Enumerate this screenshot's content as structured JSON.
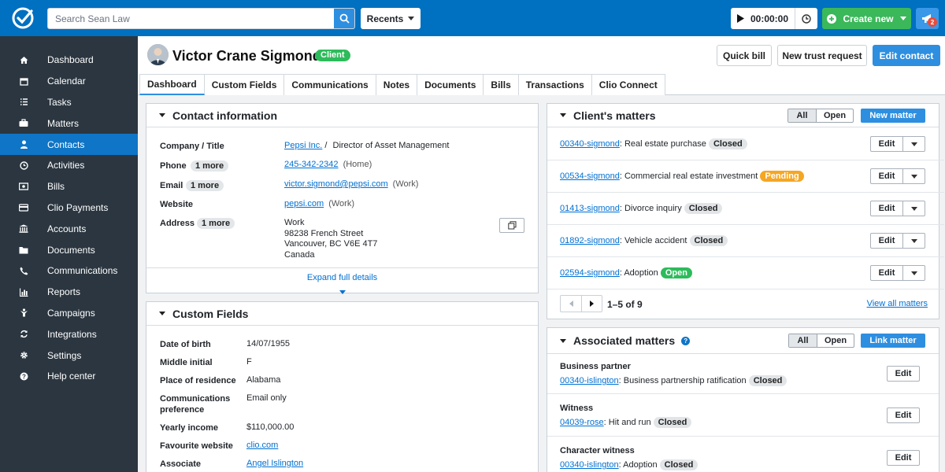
{
  "topbar": {
    "search_placeholder": "Search Sean Law",
    "recents_label": "Recents",
    "timer_value": "00:00:00",
    "create_new_label": "Create new",
    "notification_count": "2"
  },
  "sidebar": {
    "items": [
      {
        "label": "Dashboard",
        "icon": "home-icon"
      },
      {
        "label": "Calendar",
        "icon": "calendar-icon"
      },
      {
        "label": "Tasks",
        "icon": "list-icon"
      },
      {
        "label": "Matters",
        "icon": "briefcase-icon"
      },
      {
        "label": "Contacts",
        "icon": "person-icon",
        "active": true
      },
      {
        "label": "Activities",
        "icon": "clock-icon"
      },
      {
        "label": "Bills",
        "icon": "bill-icon"
      },
      {
        "label": "Clio Payments",
        "icon": "card-icon"
      },
      {
        "label": "Accounts",
        "icon": "bank-icon"
      },
      {
        "label": "Documents",
        "icon": "folder-icon"
      },
      {
        "label": "Communications",
        "icon": "phone-icon"
      },
      {
        "label": "Reports",
        "icon": "chart-icon"
      },
      {
        "label": "Campaigns",
        "icon": "megaphone-icon"
      },
      {
        "label": "Integrations",
        "icon": "sync-icon"
      },
      {
        "label": "Settings",
        "icon": "gear-icon"
      },
      {
        "label": "Help center",
        "icon": "help-icon"
      }
    ]
  },
  "header": {
    "name": "Victor Crane Sigmond",
    "badge": "Client",
    "quick_bill": "Quick bill",
    "new_trust_request": "New trust request",
    "edit_contact": "Edit contact"
  },
  "tabs": [
    "Dashboard",
    "Custom Fields",
    "Communications",
    "Notes",
    "Documents",
    "Bills",
    "Transactions",
    "Clio Connect"
  ],
  "contact_info": {
    "title": "Contact information",
    "company_label": "Company / Title",
    "company": "Pepsi Inc.",
    "company_sep": "/",
    "job_title": "Director of Asset Management",
    "phone_label": "Phone",
    "phone_more": "1 more",
    "phone": "245-342-2342",
    "phone_type": "(Home)",
    "email_label": "Email",
    "email_more": "1 more",
    "email": "victor.sigmond@pepsi.com",
    "email_type": "(Work)",
    "website_label": "Website",
    "website": "pepsi.com",
    "website_type": "(Work)",
    "address_label": "Address",
    "address_more": "1 more",
    "address_lines": [
      "Work",
      "98238 French Street",
      "Vancouver, BC V6E 4T7",
      "Canada"
    ],
    "expand": "Expand full details"
  },
  "custom_fields": {
    "title": "Custom Fields",
    "rows": [
      {
        "label": "Date of birth",
        "value": "14/07/1955"
      },
      {
        "label": "Middle initial",
        "value": "F"
      },
      {
        "label": "Place of residence",
        "value": "Alabama"
      },
      {
        "label": "Communications preference",
        "value": "Email only"
      },
      {
        "label": "Yearly income",
        "value": "$110,000.00"
      },
      {
        "label": "Favourite website",
        "value": "clio.com",
        "link": true
      },
      {
        "label": "Associate",
        "value": "Angel Islington",
        "link": true
      }
    ]
  },
  "clients_matters": {
    "title": "Client's matters",
    "filter_all": "All",
    "filter_open": "Open",
    "new_matter": "New matter",
    "edit_label": "Edit",
    "rows": [
      {
        "id": "00340-sigmond",
        "desc": ": Real estate purchase",
        "status": "Closed",
        "kind": "closed"
      },
      {
        "id": "00534-sigmond",
        "desc": ": Commercial real estate investment",
        "status": "Pending",
        "kind": "pending"
      },
      {
        "id": "01413-sigmond",
        "desc": ": Divorce inquiry",
        "status": "Closed",
        "kind": "closed"
      },
      {
        "id": "01892-sigmond",
        "desc": ": Vehicle accident",
        "status": "Closed",
        "kind": "closed"
      },
      {
        "id": "02594-sigmond",
        "desc": ": Adoption",
        "status": "Open",
        "kind": "open"
      }
    ],
    "pagination": "1–5 of 9",
    "view_all": "View all matters"
  },
  "associated_matters": {
    "title": "Associated matters",
    "filter_all": "All",
    "filter_open": "Open",
    "link_matter": "Link matter",
    "edit_label": "Edit",
    "rows": [
      {
        "role": "Business partner",
        "id": "00340-islington",
        "desc": ": Business partnership ratification",
        "status": "Closed"
      },
      {
        "role": "Witness",
        "id": "04039-rose",
        "desc": ": Hit and run",
        "status": "Closed"
      },
      {
        "role": "Character witness",
        "id": "00340-islington",
        "desc": ": Adoption",
        "status": "Closed"
      }
    ]
  },
  "colors": {
    "topbar": "#0070c0",
    "sidebar": "#2b3640",
    "active_nav": "#0f75c6",
    "primary": "#2e8fe0",
    "green": "#2dbb5b",
    "pending": "#f5a623",
    "link": "#0070d2"
  }
}
